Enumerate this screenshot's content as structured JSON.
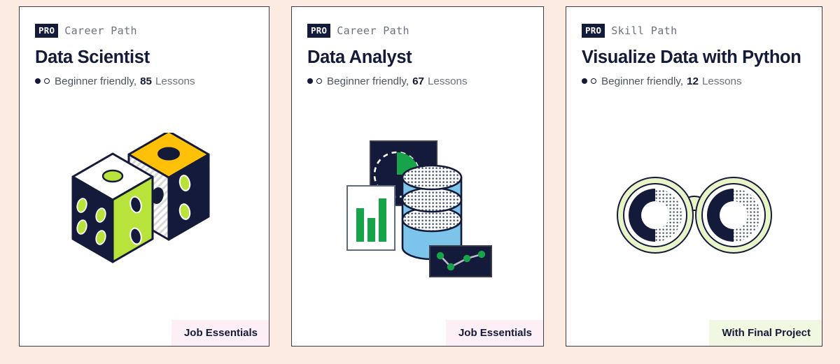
{
  "page": {
    "background_color": "#fbebe0",
    "card_background": "#ffffff",
    "card_border_color": "#3d3a4b",
    "ink_color": "#141a39"
  },
  "cards": [
    {
      "pro_label": "PRO",
      "path_type": "Career Path",
      "title": "Data Scientist",
      "level": "Beginner friendly,",
      "lesson_count": "85",
      "lesson_word": "Lessons",
      "difficulty_filled": 1,
      "difficulty_total": 2,
      "badge_label": "Job Essentials",
      "badge_color": "#fdeff6",
      "illustration": "dice-pair-icon"
    },
    {
      "pro_label": "PRO",
      "path_type": "Career Path",
      "title": "Data Analyst",
      "level": "Beginner friendly,",
      "lesson_count": "67",
      "lesson_word": "Lessons",
      "difficulty_filled": 1,
      "difficulty_total": 2,
      "badge_label": "Job Essentials",
      "badge_color": "#fdeff6",
      "illustration": "database-charts-icon"
    },
    {
      "pro_label": "PRO",
      "path_type": "Skill Path",
      "title": "Visualize Data with Python",
      "level": "Beginner friendly,",
      "lesson_count": "12",
      "lesson_word": "Lessons",
      "difficulty_filled": 1,
      "difficulty_total": 2,
      "badge_label": "With Final Project",
      "badge_color": "#f0f8e2",
      "illustration": "binoculars-icon"
    }
  ],
  "illustration_colors": {
    "navy": "#141a39",
    "lime": "#b7e33a",
    "yellow": "#ffc107",
    "white": "#ffffff",
    "green": "#16a34a",
    "blue": "#7cc4ea",
    "pale_green": "#e8f5c8"
  }
}
